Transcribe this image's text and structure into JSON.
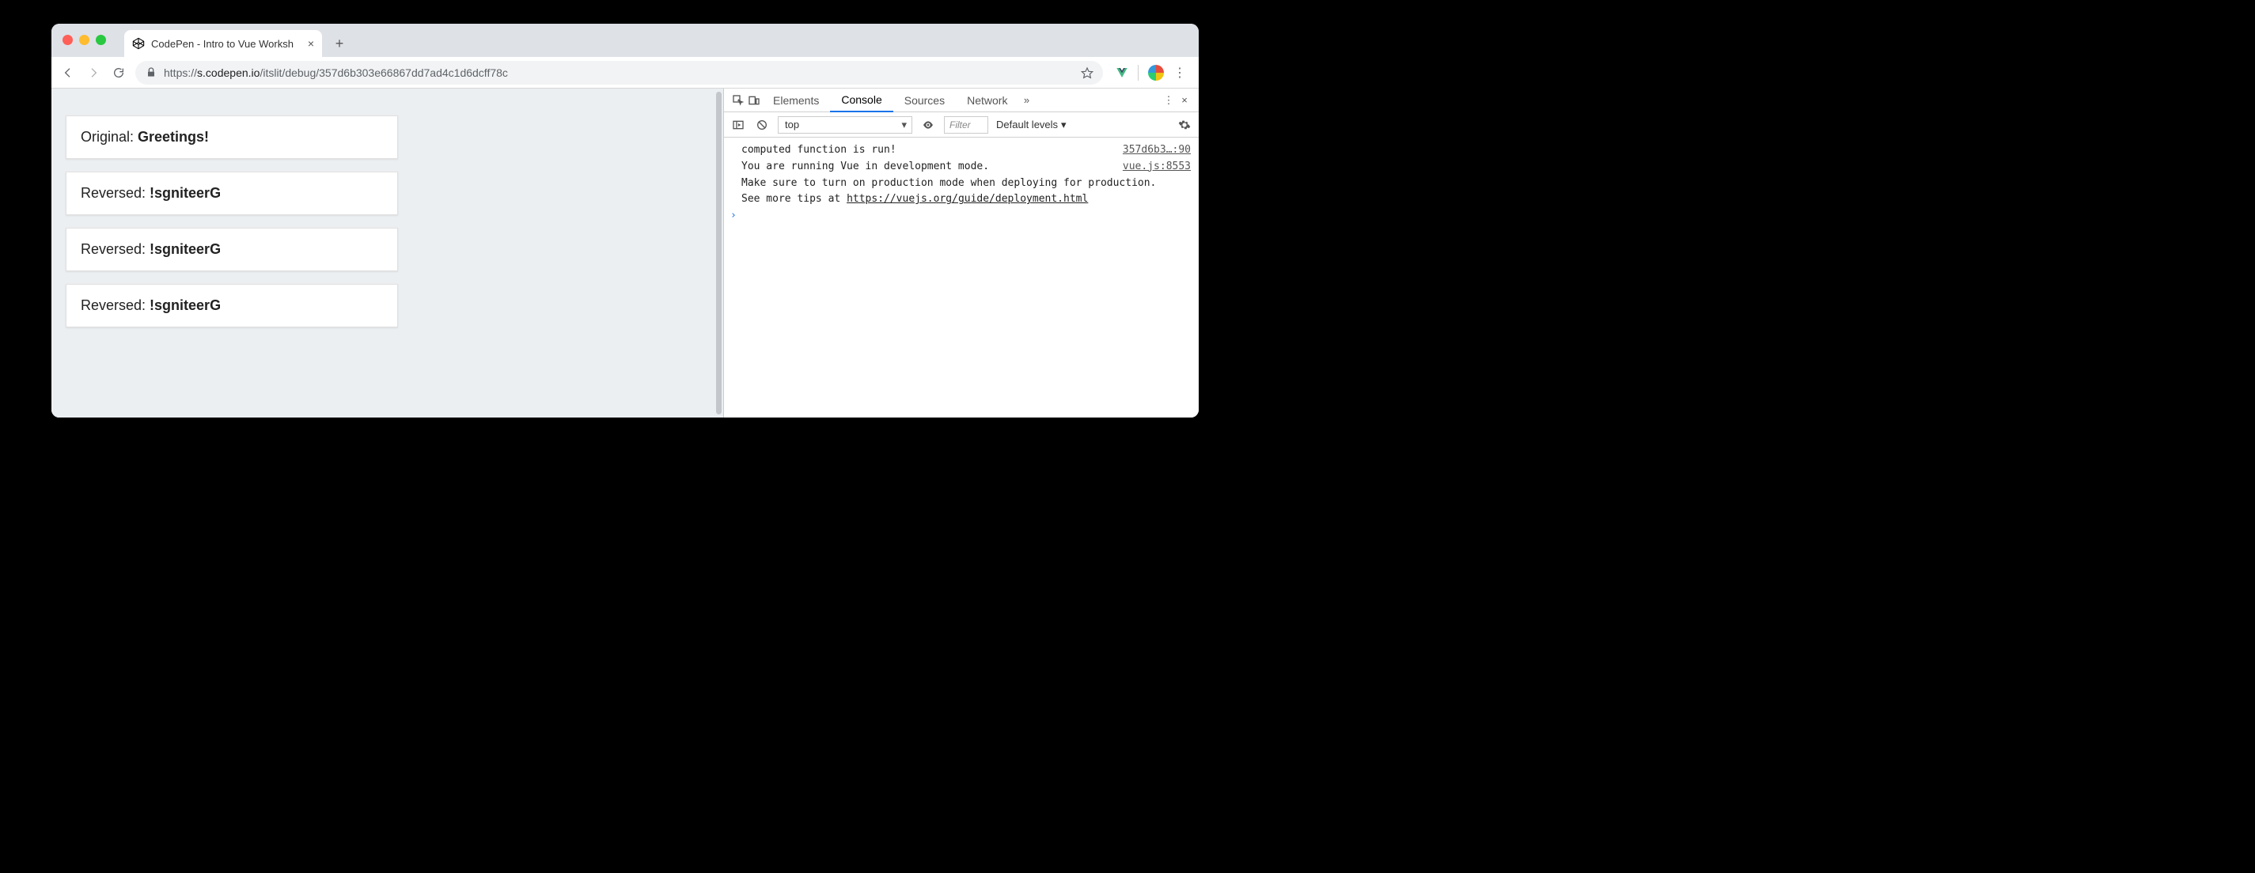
{
  "tab": {
    "title": "CodePen - Intro to Vue Worksh"
  },
  "url": {
    "scheme": "https://",
    "host": "s.codepen.io",
    "path": "/itslit/debug/357d6b303e66867dd7ad4c1d6dcff78c"
  },
  "page": {
    "cards": [
      {
        "label": "Original: ",
        "value": "Greetings!"
      },
      {
        "label": "Reversed: ",
        "value": "!sgniteerG"
      },
      {
        "label": "Reversed: ",
        "value": "!sgniteerG"
      },
      {
        "label": "Reversed: ",
        "value": "!sgniteerG"
      }
    ]
  },
  "devtools": {
    "tabs": [
      "Elements",
      "Console",
      "Sources",
      "Network"
    ],
    "active_tab": "Console",
    "context": "top",
    "filter_placeholder": "Filter",
    "levels": "Default levels",
    "logs": [
      {
        "text": "computed function is run!",
        "src": "357d6b3…:90"
      }
    ],
    "vue_msg": {
      "line1": "You are running Vue in development mode.",
      "line2": "Make sure to turn on production mode when deploying for production.",
      "line3_prefix": "See more tips at ",
      "line3_link": "https://vuejs.org/guide/deployment.html",
      "src": "vue.js:8553"
    }
  }
}
